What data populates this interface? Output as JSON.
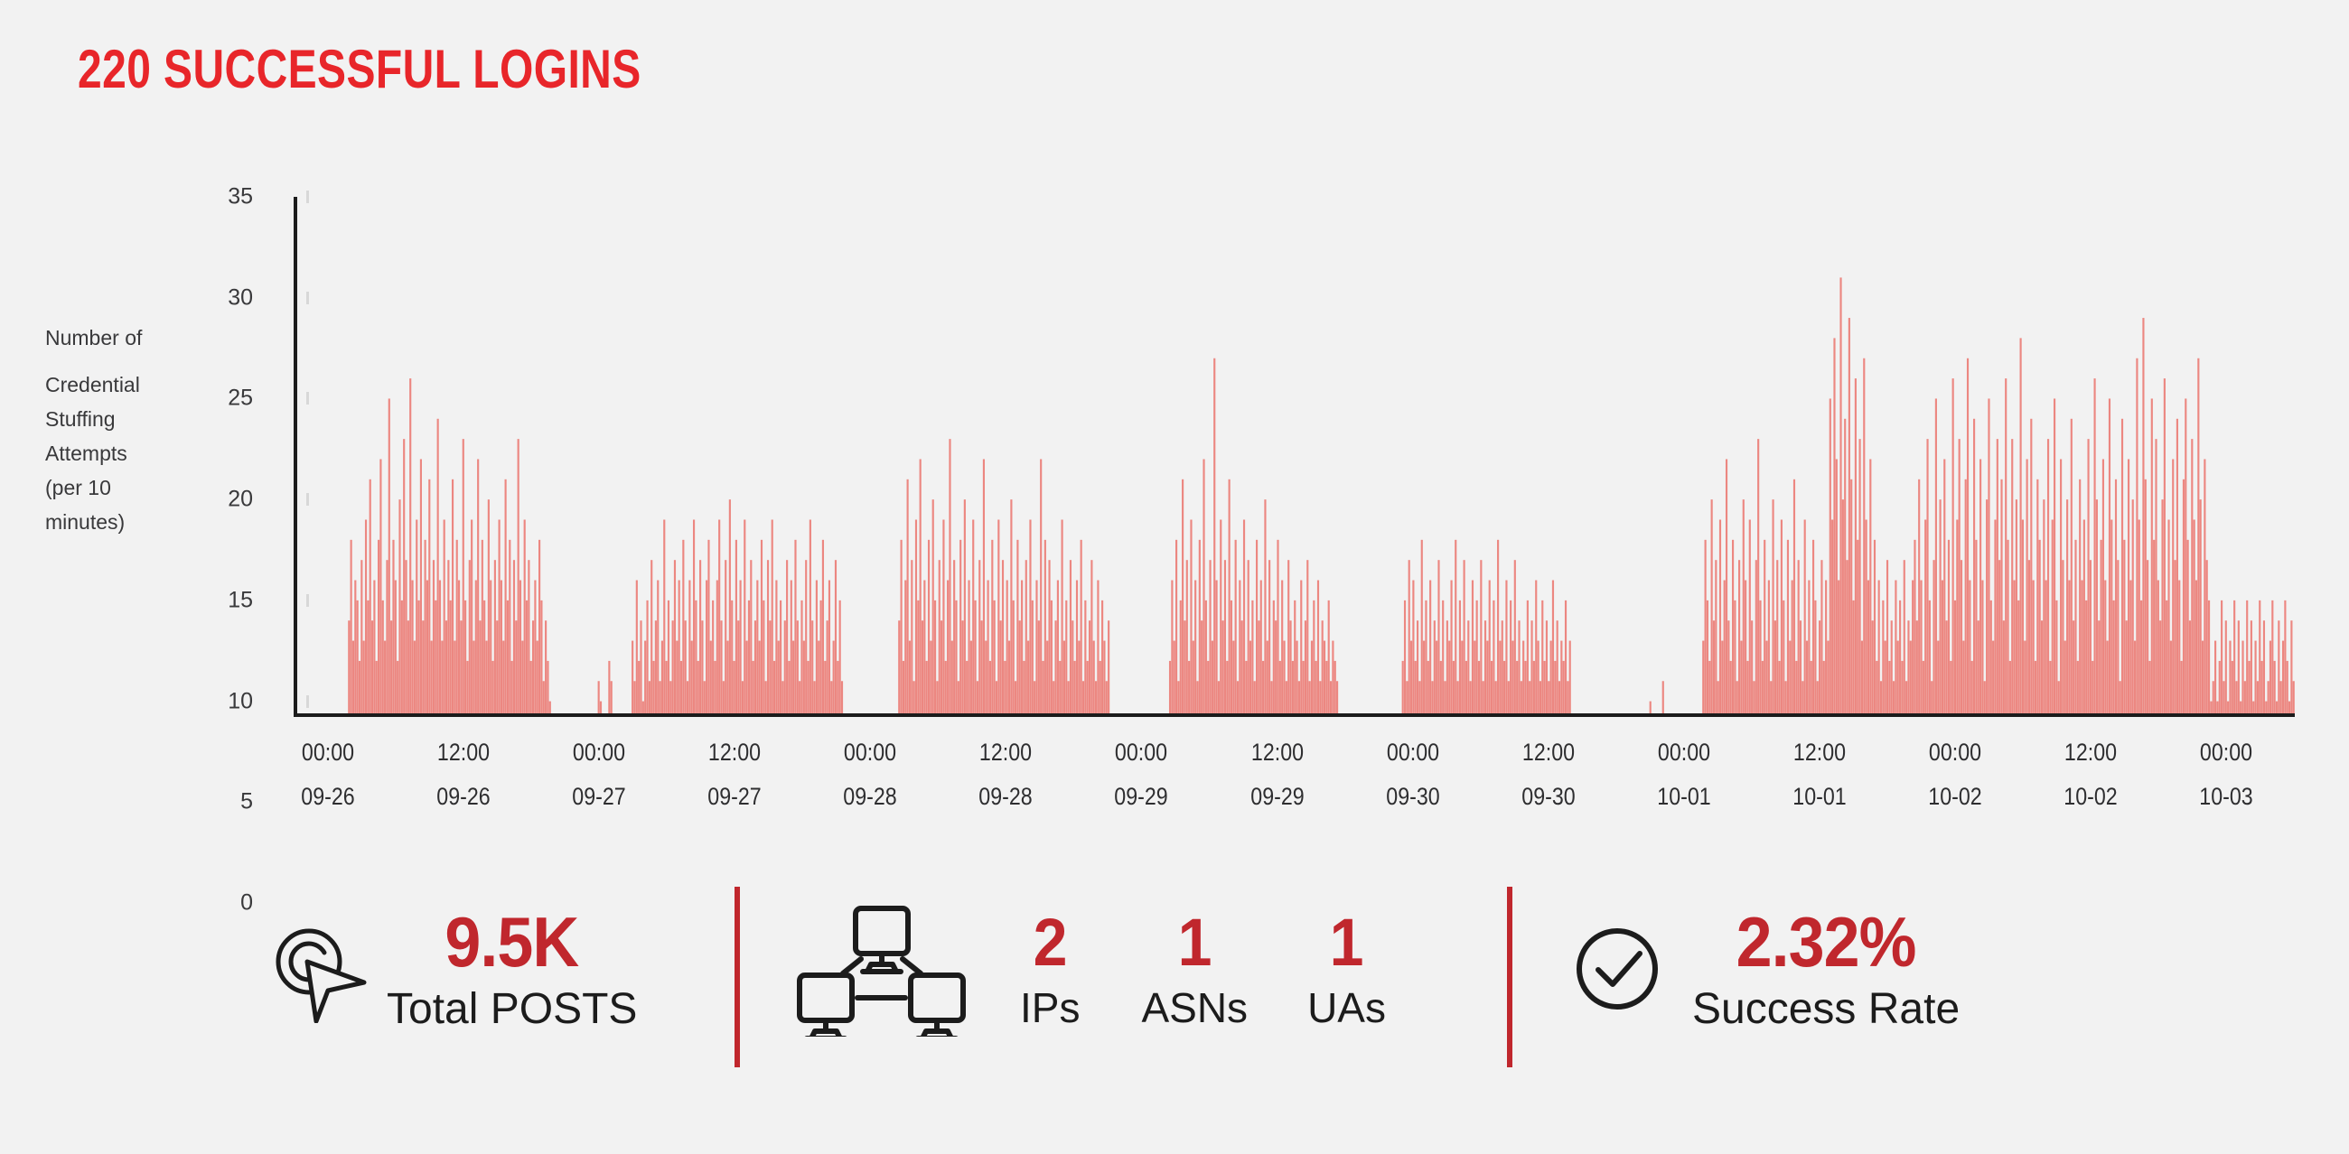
{
  "page": {
    "title": "220 SUCCESSFUL LOGINS",
    "background_color": "#f2f2f2",
    "accent_red": "#e8262a",
    "stat_red": "#c0272d",
    "bar_red": "#e8453c"
  },
  "chart_data": {
    "type": "bar",
    "title": "220 SUCCESSFUL LOGINS",
    "xlabel": "",
    "ylabel": "Number of Credential Stuffing Attempts (per 10 minutes)",
    "ylabel_lines": [
      "Number of",
      "Credential",
      "Stuffing",
      "Attempts",
      "(per 10",
      "minutes)"
    ],
    "ylim": [
      0,
      35
    ],
    "y_ticks": [
      35,
      30,
      25,
      20,
      15,
      10,
      5,
      0
    ],
    "y_axis_visible_min": 9.4,
    "grid": false,
    "legend": null,
    "baseline": 9.4,
    "x_ticks": [
      {
        "time": "00:00",
        "date": "09-26"
      },
      {
        "time": "12:00",
        "date": "09-26"
      },
      {
        "time": "00:00",
        "date": "09-27"
      },
      {
        "time": "12:00",
        "date": "09-27"
      },
      {
        "time": "00:00",
        "date": "09-28"
      },
      {
        "time": "12:00",
        "date": "09-28"
      },
      {
        "time": "00:00",
        "date": "09-29"
      },
      {
        "time": "12:00",
        "date": "09-29"
      },
      {
        "time": "00:00",
        "date": "09-30"
      },
      {
        "time": "12:00",
        "date": "09-30"
      },
      {
        "time": "00:00",
        "date": "10-01"
      },
      {
        "time": "12:00",
        "date": "10-01"
      },
      {
        "time": "00:00",
        "date": "10-02"
      },
      {
        "time": "12:00",
        "date": "10-02"
      },
      {
        "time": "00:00",
        "date": "10-03"
      }
    ],
    "x_range": [
      "09-25 21:30",
      "10-03 04:00"
    ],
    "series_name": "Credential Stuffing Attempts per 10 minutes",
    "note": "values are per-10-minute bucket counts; 0 means no activity in that bucket",
    "values": [
      0,
      0,
      0,
      0,
      0,
      0,
      0,
      0,
      0,
      0,
      0,
      0,
      0,
      0,
      0,
      0,
      0,
      0,
      0,
      0,
      0,
      0,
      0,
      0,
      14,
      18,
      13,
      16,
      15,
      12,
      17,
      13,
      19,
      15,
      21,
      14,
      16,
      12,
      18,
      22,
      15,
      13,
      17,
      25,
      14,
      18,
      16,
      12,
      20,
      15,
      23,
      17,
      14,
      26,
      16,
      13,
      19,
      15,
      22,
      14,
      18,
      16,
      21,
      13,
      17,
      15,
      24,
      16,
      13,
      19,
      14,
      17,
      15,
      21,
      13,
      18,
      16,
      14,
      23,
      15,
      12,
      17,
      19,
      13,
      16,
      22,
      14,
      18,
      15,
      13,
      20,
      16,
      12,
      17,
      14,
      19,
      16,
      13,
      21,
      15,
      18,
      12,
      17,
      14,
      23,
      16,
      13,
      19,
      15,
      17,
      12,
      14,
      16,
      13,
      18,
      15,
      11,
      14,
      12,
      10,
      0,
      0,
      0,
      0,
      0,
      0,
      0,
      0,
      0,
      0,
      0,
      0,
      0,
      0,
      0,
      0,
      0,
      0,
      0,
      0,
      0,
      0,
      11,
      10,
      0,
      0,
      0,
      12,
      11,
      0,
      0,
      0,
      0,
      0,
      0,
      0,
      0,
      0,
      13,
      11,
      16,
      12,
      14,
      10,
      13,
      15,
      11,
      17,
      12,
      14,
      16,
      11,
      13,
      19,
      12,
      15,
      11,
      14,
      17,
      13,
      16,
      12,
      18,
      14,
      11,
      16,
      13,
      19,
      15,
      12,
      17,
      14,
      11,
      16,
      18,
      13,
      15,
      12,
      16,
      19,
      14,
      11,
      17,
      13,
      20,
      15,
      12,
      18,
      14,
      16,
      11,
      19,
      13,
      15,
      17,
      12,
      14,
      16,
      13,
      18,
      15,
      11,
      17,
      14,
      19,
      12,
      16,
      13,
      15,
      11,
      14,
      17,
      12,
      16,
      13,
      18,
      14,
      11,
      15,
      13,
      17,
      12,
      19,
      14,
      11,
      16,
      13,
      15,
      18,
      12,
      14,
      16,
      11,
      13,
      17,
      12,
      15,
      11,
      0,
      0,
      0,
      0,
      0,
      0,
      0,
      0,
      0,
      0,
      0,
      0,
      0,
      0,
      0,
      0,
      0,
      0,
      0,
      0,
      0,
      0,
      0,
      0,
      0,
      0,
      14,
      18,
      12,
      16,
      21,
      13,
      17,
      11,
      19,
      15,
      22,
      14,
      16,
      12,
      18,
      13,
      20,
      15,
      11,
      17,
      14,
      19,
      12,
      16,
      23,
      13,
      17,
      15,
      11,
      18,
      14,
      20,
      12,
      16,
      13,
      19,
      15,
      11,
      17,
      14,
      22,
      13,
      16,
      12,
      18,
      15,
      11,
      19,
      14,
      17,
      12,
      16,
      13,
      20,
      15,
      11,
      18,
      14,
      16,
      12,
      17,
      13,
      19,
      15,
      11,
      16,
      14,
      22,
      12,
      18,
      13,
      17,
      15,
      11,
      14,
      16,
      12,
      19,
      13,
      15,
      11,
      17,
      14,
      12,
      16,
      13,
      18,
      11,
      15,
      12,
      14,
      17,
      13,
      11,
      16,
      12,
      15,
      13,
      11,
      14,
      0,
      0,
      0,
      0,
      0,
      0,
      0,
      0,
      0,
      0,
      0,
      0,
      0,
      0,
      0,
      0,
      0,
      0,
      0,
      0,
      0,
      0,
      0,
      0,
      0,
      0,
      0,
      0,
      12,
      16,
      13,
      18,
      11,
      15,
      21,
      14,
      17,
      12,
      19,
      13,
      16,
      11,
      18,
      14,
      22,
      15,
      12,
      17,
      13,
      27,
      16,
      11,
      19,
      14,
      17,
      12,
      21,
      15,
      13,
      18,
      11,
      16,
      14,
      19,
      12,
      17,
      13,
      15,
      11,
      18,
      14,
      16,
      12,
      20,
      13,
      17,
      11,
      15,
      14,
      18,
      12,
      16,
      13,
      11,
      17,
      14,
      12,
      15,
      13,
      11,
      16,
      12,
      14,
      17,
      11,
      13,
      15,
      12,
      16,
      11,
      14,
      13,
      12,
      15,
      11,
      13,
      12,
      11,
      0,
      0,
      0,
      0,
      0,
      0,
      0,
      0,
      0,
      0,
      0,
      0,
      0,
      0,
      0,
      0,
      0,
      0,
      0,
      0,
      0,
      0,
      0,
      0,
      0,
      0,
      0,
      0,
      0,
      0,
      12,
      15,
      11,
      17,
      13,
      16,
      12,
      14,
      11,
      18,
      13,
      15,
      12,
      16,
      11,
      14,
      13,
      17,
      12,
      15,
      11,
      14,
      13,
      16,
      12,
      18,
      11,
      15,
      13,
      17,
      12,
      14,
      11,
      16,
      13,
      15,
      12,
      17,
      11,
      14,
      13,
      16,
      12,
      15,
      11,
      18,
      13,
      14,
      12,
      16,
      11,
      15,
      13,
      17,
      12,
      14,
      11,
      13,
      12,
      15,
      11,
      14,
      12,
      16,
      13,
      11,
      15,
      12,
      14,
      11,
      13,
      16,
      12,
      14,
      11,
      13,
      12,
      15,
      11,
      13,
      0,
      0,
      0,
      0,
      0,
      0,
      0,
      0,
      0,
      0,
      0,
      0,
      0,
      0,
      0,
      0,
      0,
      0,
      0,
      0,
      0,
      0,
      0,
      0,
      0,
      0,
      0,
      0,
      0,
      0,
      0,
      0,
      0,
      0,
      0,
      0,
      0,
      10,
      0,
      0,
      0,
      0,
      0,
      11,
      0,
      0,
      0,
      0,
      0,
      0,
      0,
      0,
      0,
      0,
      0,
      0,
      0,
      0,
      0,
      0,
      0,
      0,
      13,
      18,
      15,
      12,
      20,
      14,
      17,
      11,
      19,
      13,
      16,
      22,
      14,
      12,
      18,
      15,
      11,
      17,
      13,
      20,
      16,
      12,
      19,
      14,
      11,
      17,
      23,
      15,
      12,
      18,
      13,
      16,
      11,
      20,
      14,
      17,
      12,
      19,
      15,
      11,
      18,
      13,
      16,
      21,
      12,
      17,
      14,
      11,
      19,
      13,
      16,
      12,
      18,
      15,
      11,
      14,
      17,
      12,
      16,
      13,
      25,
      19,
      28,
      22,
      16,
      31,
      20,
      24,
      17,
      29,
      21,
      15,
      26,
      18,
      23,
      13,
      27,
      19,
      16,
      22,
      14,
      18,
      12,
      16,
      11,
      15,
      13,
      17,
      12,
      14,
      11,
      16,
      13,
      15,
      12,
      17,
      11,
      14,
      13,
      16,
      18,
      14,
      21,
      16,
      12,
      19,
      23,
      15,
      11,
      17,
      25,
      13,
      20,
      16,
      22,
      14,
      18,
      12,
      26,
      15,
      19,
      23,
      17,
      13,
      21,
      27,
      16,
      12,
      24,
      18,
      14,
      22,
      16,
      11,
      20,
      25,
      15,
      13,
      19,
      23,
      17,
      21,
      14,
      26,
      18,
      12,
      23,
      16,
      20,
      15,
      28,
      19,
      13,
      22,
      17,
      24,
      16,
      12,
      21,
      18,
      14,
      20,
      16,
      23,
      12,
      19,
      25,
      15,
      11,
      22,
      17,
      13,
      20,
      16,
      24,
      14,
      18,
      12,
      21,
      16,
      19,
      15,
      23,
      17,
      12,
      26,
      20,
      14,
      18,
      22,
      16,
      13,
      25,
      19,
      15,
      21,
      17,
      11,
      24,
      18,
      14,
      22,
      16,
      20,
      13,
      27,
      19,
      15,
      29,
      21,
      17,
      12,
      25,
      18,
      23,
      16,
      14,
      20,
      26,
      15,
      19,
      13,
      22,
      17,
      24,
      16,
      12,
      21,
      25,
      18,
      14,
      23,
      19,
      16,
      27,
      20,
      13,
      22,
      17,
      15,
      10,
      11,
      13,
      10,
      12,
      15,
      11,
      14,
      10,
      13,
      12,
      15,
      11,
      14,
      10,
      13,
      11,
      15,
      12,
      14,
      10,
      13,
      11,
      15,
      12,
      14,
      10,
      11,
      13,
      15,
      12,
      10,
      14,
      11,
      13,
      15,
      12,
      10,
      14,
      11
    ]
  },
  "stats": [
    {
      "id": "total-posts",
      "icon": "click-cursor-icon",
      "value": "9.5K",
      "label": "Total POSTS",
      "sub": []
    },
    {
      "id": "network",
      "icon": "network-devices-icon",
      "value": null,
      "label": null,
      "sub": [
        {
          "value": "2",
          "label": "IPs"
        },
        {
          "value": "1",
          "label": "ASNs"
        },
        {
          "value": "1",
          "label": "UAs"
        }
      ]
    },
    {
      "id": "success-rate",
      "icon": "check-circle-icon",
      "value": "2.32%",
      "label": "Success Rate",
      "sub": []
    }
  ]
}
